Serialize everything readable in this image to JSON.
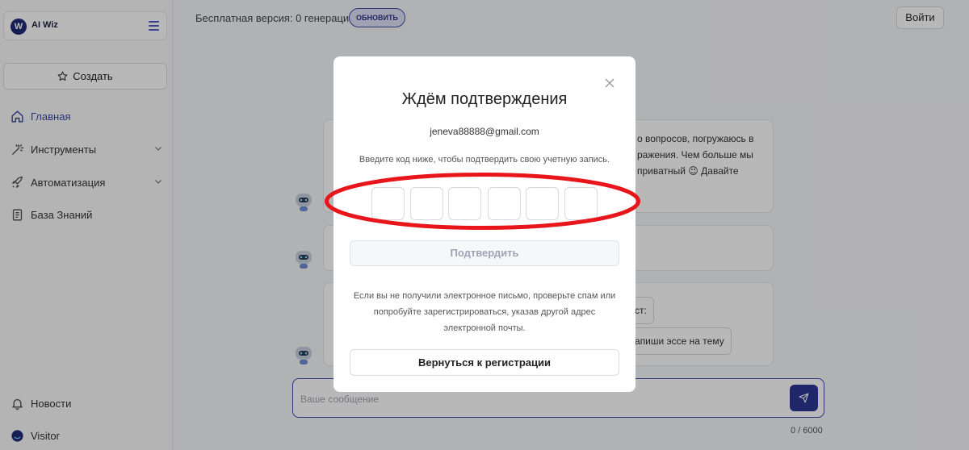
{
  "sidebar": {
    "logo_text": "AI Wiz",
    "logo_letter": "W",
    "create_label": "Создать",
    "nav": [
      {
        "label": "Главная"
      },
      {
        "label": "Инструменты"
      },
      {
        "label": "Автоматизация"
      },
      {
        "label": "База Знаний"
      }
    ],
    "bottom": [
      {
        "label": "Новости"
      },
      {
        "label": "Visitor"
      }
    ]
  },
  "topbar": {
    "free_version": "Бесплатная версия: 0 генераций",
    "upgrade_label": "ОБНОВИТЬ",
    "login_label": "Войти"
  },
  "chat": {
    "message_lines": [
      "о вопросов, погружаюсь в",
      "ражения. Чем больше мы",
      "приватный 😉 Давайте"
    ],
    "chip_1": "ст:",
    "chip_2": "апиши эссе на тему",
    "composer_placeholder": "Ваше сообщение",
    "counter": "0 / 6000"
  },
  "modal": {
    "title": "Ждём подтверждения",
    "email": "jeneva88888@gmail.com",
    "instruction": "Введите код ниже, чтобы подтвердить свою учетную запись.",
    "code_slots": [
      "",
      "",
      "",
      "",
      "",
      ""
    ],
    "confirm_label": "Подтвердить",
    "help_text": "Если вы не получили электронное письмо, проверьте спам или попробуйте зарегистрироваться, указав другой адрес электронной почты.",
    "back_label": "Вернуться к регистрации"
  },
  "colors": {
    "accent": "#2c3593",
    "highlight_ring": "#e8151b"
  }
}
